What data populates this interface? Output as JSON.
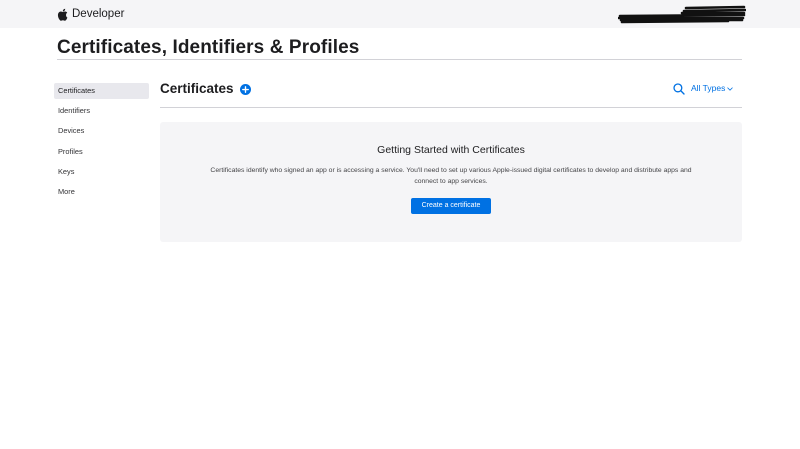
{
  "topbar": {
    "brand": "Developer",
    "logo_icon": "apple-logo-icon",
    "account_name_redacted": true
  },
  "page": {
    "title": "Certificates, Identifiers & Profiles"
  },
  "sidebar": {
    "items": [
      {
        "label": "Certificates",
        "active": true
      },
      {
        "label": "Identifiers",
        "active": false
      },
      {
        "label": "Devices",
        "active": false
      },
      {
        "label": "Profiles",
        "active": false
      },
      {
        "label": "Keys",
        "active": false
      },
      {
        "label": "More",
        "active": false
      }
    ]
  },
  "section": {
    "title": "Certificates",
    "add_icon": "plus-circle-icon",
    "search_icon": "search-icon",
    "filter": {
      "selected": "All Types",
      "icon": "chevron-down-icon"
    }
  },
  "empty_state": {
    "title": "Getting Started with Certificates",
    "description": "Certificates identify who signed an app or is accessing a service. You'll need to set up various Apple-issued digital certificates to develop and distribute apps and connect to app services.",
    "button_label": "Create a certificate"
  },
  "colors": {
    "accent": "#0071e3",
    "topbar_bg": "#f5f5f7",
    "card_bg": "#f5f5f7",
    "active_sidebar_bg": "#e8e8ed",
    "rule": "#d2d2d7"
  }
}
